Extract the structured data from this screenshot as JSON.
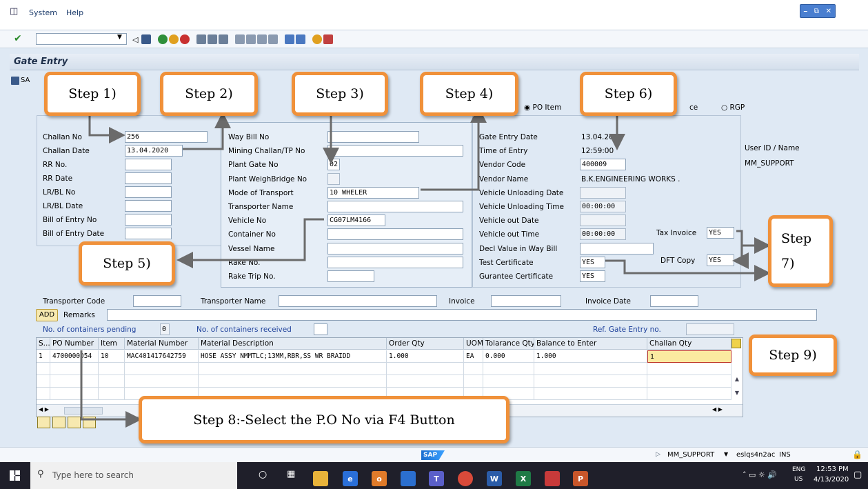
{
  "menu": {
    "system": "System",
    "help": "Help"
  },
  "screen_title": "Gate Entry",
  "save_label": "SA",
  "options": {
    "po_item": "PO Item",
    "other": "ce",
    "rgp": "RGP"
  },
  "col1": [
    {
      "label": "Challan No",
      "value": "256"
    },
    {
      "label": "Challan Date",
      "value": "13.04.2020"
    },
    {
      "label": "RR No.",
      "value": ""
    },
    {
      "label": "RR Date",
      "value": ""
    },
    {
      "label": "LR/BL No",
      "value": ""
    },
    {
      "label": "LR/BL Date",
      "value": ""
    },
    {
      "label": "Bill of Entry No",
      "value": ""
    },
    {
      "label": "Bill of Entry Date",
      "value": ""
    }
  ],
  "col2": [
    {
      "label": "Way Bill No",
      "value": ""
    },
    {
      "label": "Mining Challan/TP No",
      "value": ""
    },
    {
      "label": "Plant Gate No",
      "value": "02"
    },
    {
      "label": "Plant WeighBridge No",
      "value": ""
    },
    {
      "label": "Mode of Transport",
      "value": "10 WHELER"
    },
    {
      "label": "Transporter Name",
      "value": ""
    },
    {
      "label": "Vehicle No",
      "value": "CG07LM4166"
    },
    {
      "label": "Container No",
      "value": ""
    },
    {
      "label": "Vessel Name",
      "value": ""
    },
    {
      "label": "Rake No.",
      "value": ""
    },
    {
      "label": "Rake Trip No.",
      "value": ""
    }
  ],
  "col3": [
    {
      "label": "Gate Entry Date",
      "value": "13.04.2020"
    },
    {
      "label": "Time of Entry",
      "value": "12:59:00"
    },
    {
      "label": "Vendor Code",
      "value": "400009"
    },
    {
      "label": "Vendor Name",
      "value": "B.K.ENGINEERING WORKS ."
    },
    {
      "label": "Vehicle Unloading Date",
      "value": ""
    },
    {
      "label": "Vehicle Unloading Time",
      "value": "00:00:00"
    },
    {
      "label": "Vehicle out Date",
      "value": ""
    },
    {
      "label": "Vehicle out Time",
      "value": "00:00:00"
    },
    {
      "label": "Decl Value in Way Bill",
      "value": ""
    },
    {
      "label": "Test Certificate",
      "value": "YES"
    },
    {
      "label": "Gurantee Certificate",
      "value": "YES"
    }
  ],
  "user": {
    "label": "User ID / Name",
    "value": "MM_SUPPORT"
  },
  "tax_invoice": {
    "label": "Tax Invoice",
    "value": "YES"
  },
  "dft_copy": {
    "label": "DFT Copy",
    "value": "YES"
  },
  "bottom": {
    "transporter_code": "Transporter Code",
    "transporter_name": "Transporter Name",
    "invoice": "Invoice",
    "invoice_date": "Invoice Date",
    "add": "ADD",
    "remarks": "Remarks",
    "pending": "No. of containers pending",
    "pending_value": "0",
    "received": "No. of containers received",
    "ref_gate": "Ref. Gate Entry no."
  },
  "grid": {
    "headers": [
      "S...",
      "PO Number",
      "Item",
      "Material Number",
      "Material Description",
      "Order Qty",
      "UOM",
      "Tolarance Qty",
      "Balance to Enter",
      "Challan Qty"
    ],
    "row": [
      "1",
      "4700000054",
      "10",
      "MAC401417642759",
      "HOSE ASSY NMMTLC;13MM,RBR,SS WR BRAIDD",
      "1.000",
      "EA",
      "0.000",
      "1.000",
      "1"
    ]
  },
  "steps": {
    "s1": "Step 1)",
    "s2": "Step 2)",
    "s3": "Step 3)",
    "s4": "Step 4)",
    "s5": "Step 5)",
    "s6": "Step 6)",
    "s7": "Step 7)",
    "s8": "Step 8:-Select the P.O No via F4 Button",
    "s9": "Step 9)"
  },
  "status": {
    "user": "MM_SUPPORT",
    "server": "eslqs4n2ac",
    "mode": "INS",
    "logo": "SAP"
  },
  "taskbar": {
    "search": "Type here to search",
    "lang1": "ENG",
    "lang2": "US",
    "time": "12:53 PM",
    "date": "4/13/2020"
  },
  "colors": {
    "accent": "#f0913a",
    "bg": "#dfe9f4"
  }
}
